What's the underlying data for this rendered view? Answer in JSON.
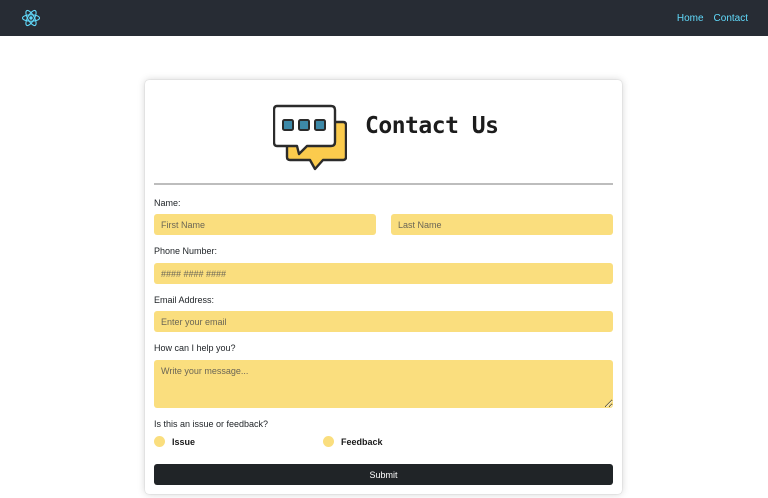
{
  "nav": {
    "links": [
      "Home",
      "Contact"
    ]
  },
  "logo": {
    "icon": "react-logo-icon",
    "color": "#61dafb"
  },
  "form": {
    "title": "Contact Us",
    "icon": "chat-bubbles-icon",
    "name_label": "Name:",
    "first_name_placeholder": "First Name",
    "last_name_placeholder": "Last Name",
    "phone_label": "Phone Number:",
    "phone_placeholder": "#### #### ####",
    "email_label": "Email Address:",
    "email_placeholder": "Enter your email",
    "message_label": "How can I help you?",
    "message_placeholder": "Write your message...",
    "type_label": "Is this an issue or feedback?",
    "options": [
      "Issue",
      "Feedback"
    ],
    "submit_label": "Submit"
  },
  "colors": {
    "navbar": "#272c34",
    "accent": "#61dafb",
    "field": "#fade7e",
    "button": "#202427"
  }
}
